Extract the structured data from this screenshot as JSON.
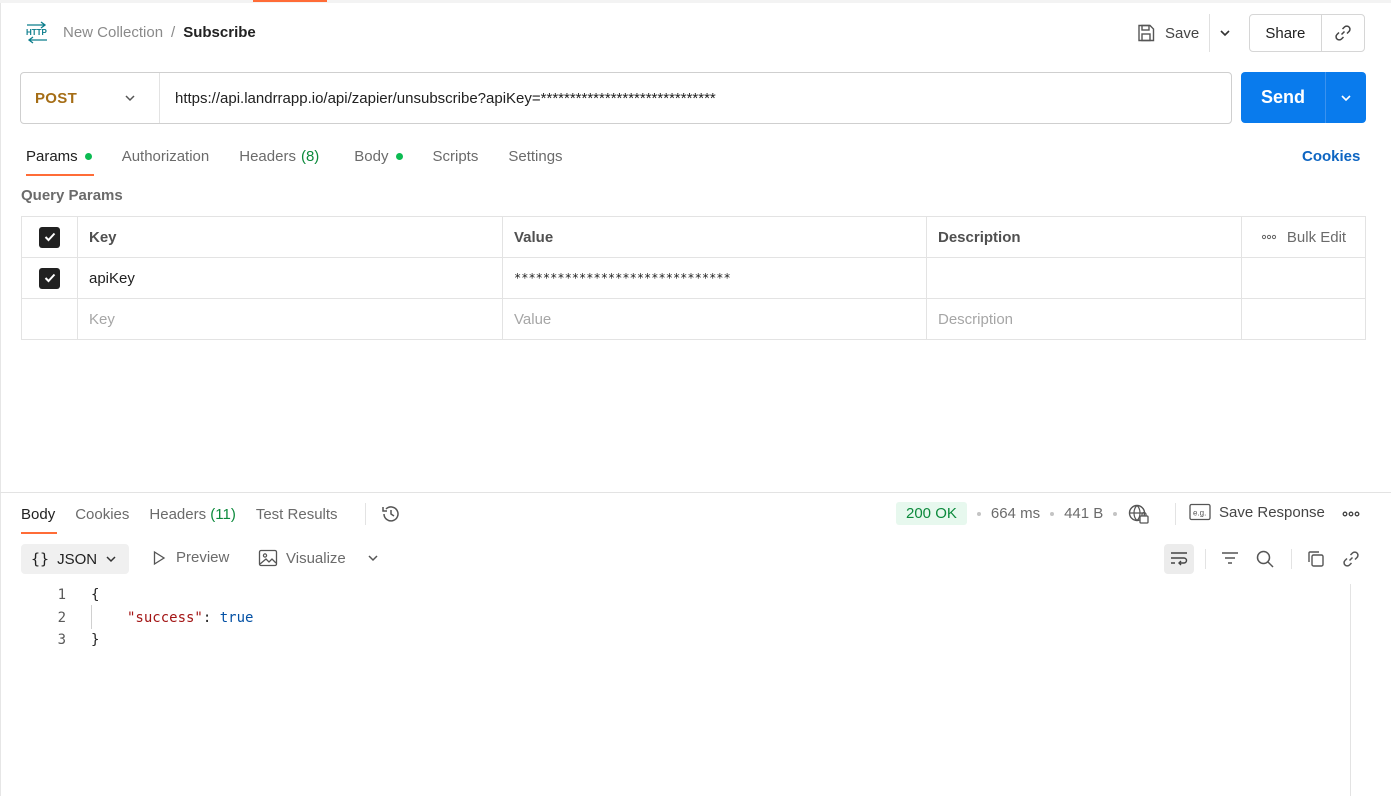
{
  "header": {
    "breadcrumb_parent": "New Collection",
    "breadcrumb_sep": "/",
    "breadcrumb_current": "Subscribe",
    "save_label": "Save",
    "share_label": "Share"
  },
  "request": {
    "method": "POST",
    "url": "https://api.landrrapp.io/api/zapier/unsubscribe?apiKey=******************************",
    "send_label": "Send"
  },
  "request_tabs": {
    "params": "Params",
    "authorization": "Authorization",
    "headers": "Headers",
    "headers_count": "(8)",
    "body": "Body",
    "scripts": "Scripts",
    "settings": "Settings",
    "cookies": "Cookies"
  },
  "params": {
    "title": "Query Params",
    "col_key": "Key",
    "col_value": "Value",
    "col_description": "Description",
    "bulk_edit": "Bulk Edit",
    "rows": [
      {
        "key": "apiKey",
        "value": "******************************",
        "description": ""
      }
    ],
    "placeholder_key": "Key",
    "placeholder_value": "Value",
    "placeholder_description": "Description"
  },
  "response_tabs": {
    "body": "Body",
    "cookies": "Cookies",
    "headers": "Headers",
    "headers_count": "(11)",
    "test_results": "Test Results"
  },
  "response_status": {
    "code": "200 OK",
    "time": "664 ms",
    "size": "441 B",
    "save_response": "Save Response"
  },
  "response_toolbar": {
    "format": "JSON",
    "preview": "Preview",
    "visualize": "Visualize"
  },
  "response_body": {
    "line_numbers": [
      "1",
      "2",
      "3"
    ],
    "open_brace": "{",
    "key": "\"success\"",
    "colon": ": ",
    "value": "true",
    "close_brace": "}"
  },
  "colors": {
    "accent": "#ff6c37",
    "send": "#097bed",
    "method": "#a56d15",
    "success": "#0c8a3c"
  }
}
